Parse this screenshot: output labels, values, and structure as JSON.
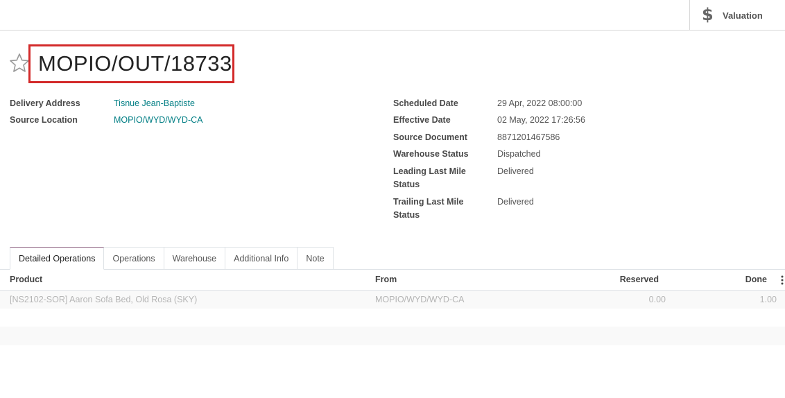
{
  "header": {
    "valuation_label": "Valuation",
    "valuation_icon": "dollar-icon"
  },
  "record": {
    "title": "MOPIO/OUT/18733",
    "favorite_icon": "star-icon",
    "highlight_color": "#d32a2a"
  },
  "left_fields": {
    "delivery_address_label": "Delivery Address",
    "delivery_address_value": "Tisnue Jean-Baptiste",
    "source_location_label": "Source Location",
    "source_location_value": "MOPIO/WYD/WYD-CA"
  },
  "right_fields": {
    "scheduled_date_label": "Scheduled Date",
    "scheduled_date_value": "29 Apr, 2022 08:00:00",
    "effective_date_label": "Effective Date",
    "effective_date_value": "02 May, 2022 17:26:56",
    "source_document_label": "Source Document",
    "source_document_value": "8871201467586",
    "warehouse_status_label": "Warehouse Status",
    "warehouse_status_value": "Dispatched",
    "leading_status_label_1": "Leading Last Mile",
    "leading_status_label_2": "Status",
    "leading_status_value": "Delivered",
    "trailing_status_label_1": "Trailing Last Mile",
    "trailing_status_label_2": "Status",
    "trailing_status_value": "Delivered"
  },
  "tabs": [
    {
      "label": "Detailed Operations",
      "active": true
    },
    {
      "label": "Operations"
    },
    {
      "label": "Warehouse"
    },
    {
      "label": "Additional Info"
    },
    {
      "label": "Note"
    }
  ],
  "table": {
    "columns": [
      "Product",
      "From",
      "Reserved",
      "Done"
    ],
    "rows": [
      {
        "product": "[NS2102-SOR] Aaron Sofa Bed, Old Rosa (SKY)",
        "from": "MOPIO/WYD/WYD-CA",
        "reserved": "0.00",
        "done": "1.00"
      }
    ]
  },
  "colors": {
    "link": "#017e84",
    "active_tab_accent": "#875a7b"
  }
}
